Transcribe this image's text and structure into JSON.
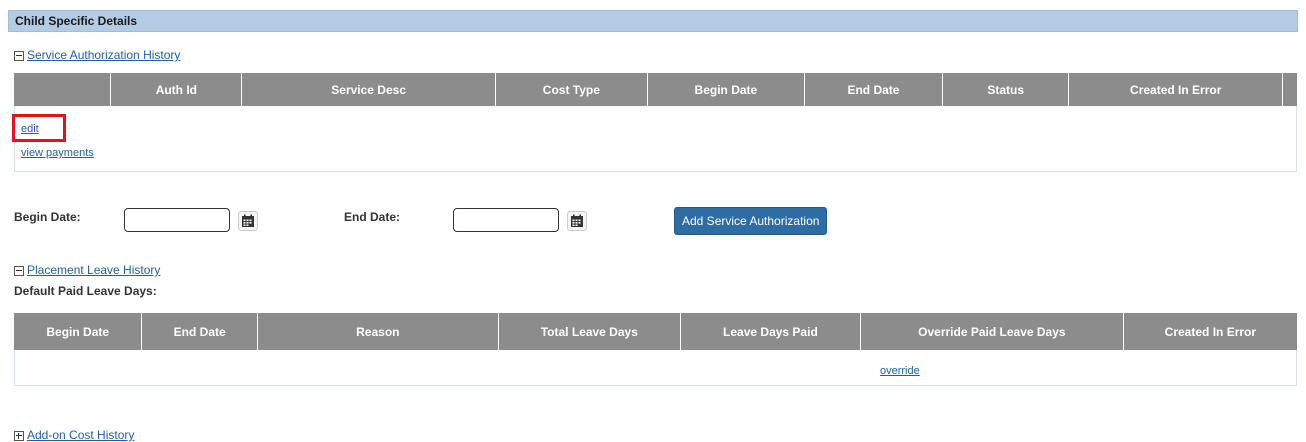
{
  "section": {
    "title": "Child Specific Details"
  },
  "service_auth": {
    "toggle_label": "Service Authorization History",
    "columns": [
      "",
      "Auth Id",
      "Service Desc",
      "Cost Type",
      "Begin Date",
      "End Date",
      "Status",
      "Created In Error",
      ""
    ],
    "row_links": {
      "edit": "edit",
      "view_payments": "view payments"
    }
  },
  "form": {
    "begin_label": "Begin Date:",
    "begin_value": "",
    "end_label": "End Date:",
    "end_value": "",
    "add_button": "Add Service Authorization"
  },
  "placement_leave": {
    "toggle_label": "Placement Leave History",
    "default_paid_label": "Default Paid Leave Days:",
    "columns": [
      "Begin Date",
      "End Date",
      "Reason",
      "Total Leave Days",
      "Leave Days Paid",
      "Override Paid Leave Days",
      "Created In Error"
    ],
    "row_link": "override"
  },
  "addon": {
    "toggle_label": "Add-on Cost History"
  },
  "colors": {
    "header_bg": "#b3cce4",
    "table_header": "#8c8c8c",
    "button": "#2e6da4",
    "highlight": "#e0141e"
  },
  "icons": {
    "calendar": "calendar-icon",
    "collapse": "minus-box-icon",
    "expand": "plus-box-icon"
  }
}
